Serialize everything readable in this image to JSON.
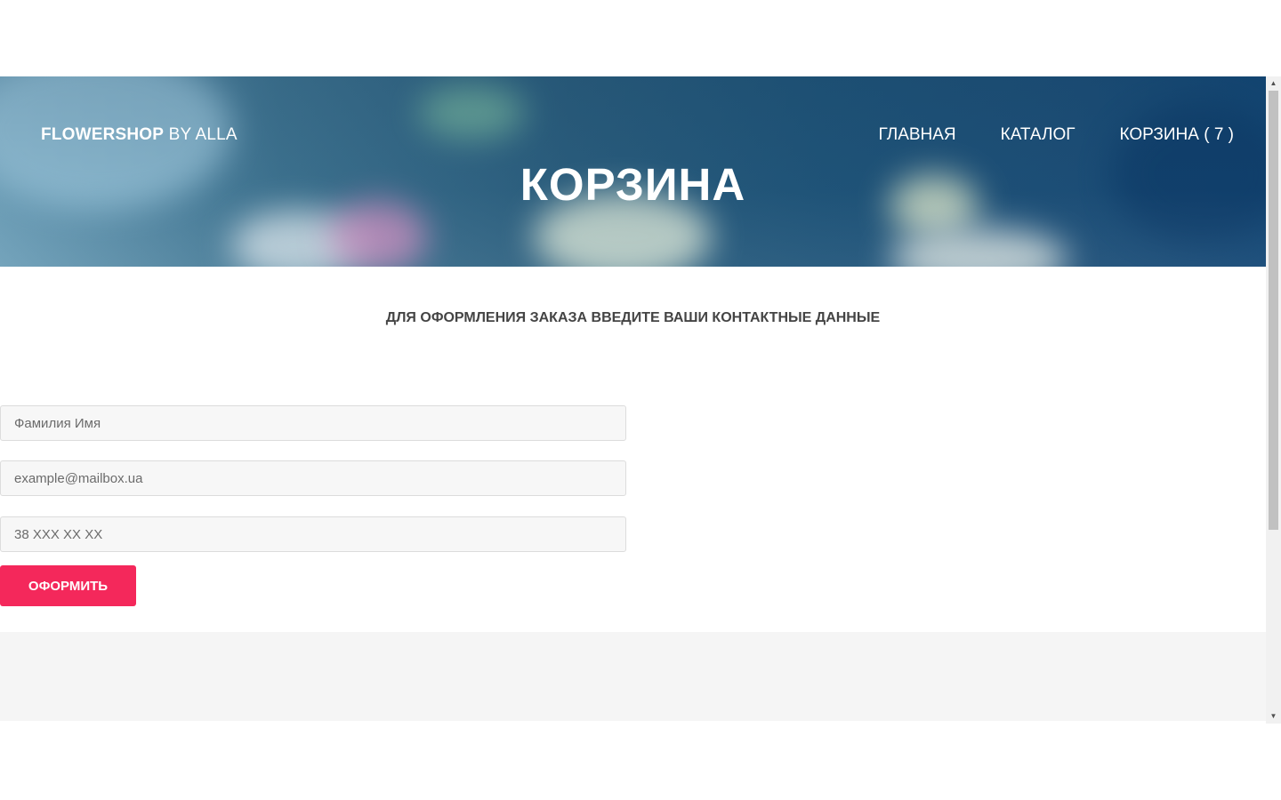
{
  "header": {
    "brand_bold": "FLOWERSHOP",
    "brand_rest": "BY ALLA",
    "nav": {
      "home": "ГЛАВНАЯ",
      "catalog": "КАТАЛОГ",
      "cart": "КОРЗИНА ( 7 )"
    },
    "page_title": "КОРЗИНА"
  },
  "form": {
    "heading": "ДЛЯ ОФОРМЛЕНИЯ ЗАКАЗА ВВЕДИТЕ ВАШИ КОНТАКТНЫЕ ДАННЫЕ",
    "name_placeholder": "Фамилия Имя",
    "email_placeholder": "example@mailbox.ua",
    "phone_placeholder": "38 XXX XX XX",
    "submit_label": "ОФОРМИТЬ"
  },
  "colors": {
    "accent": "#f4285b",
    "hero_tint": "#1d4f78",
    "field_bg": "#f7f7f7"
  },
  "icons": {
    "scroll_up": "chevron-up-icon",
    "scroll_down": "chevron-down-icon"
  }
}
